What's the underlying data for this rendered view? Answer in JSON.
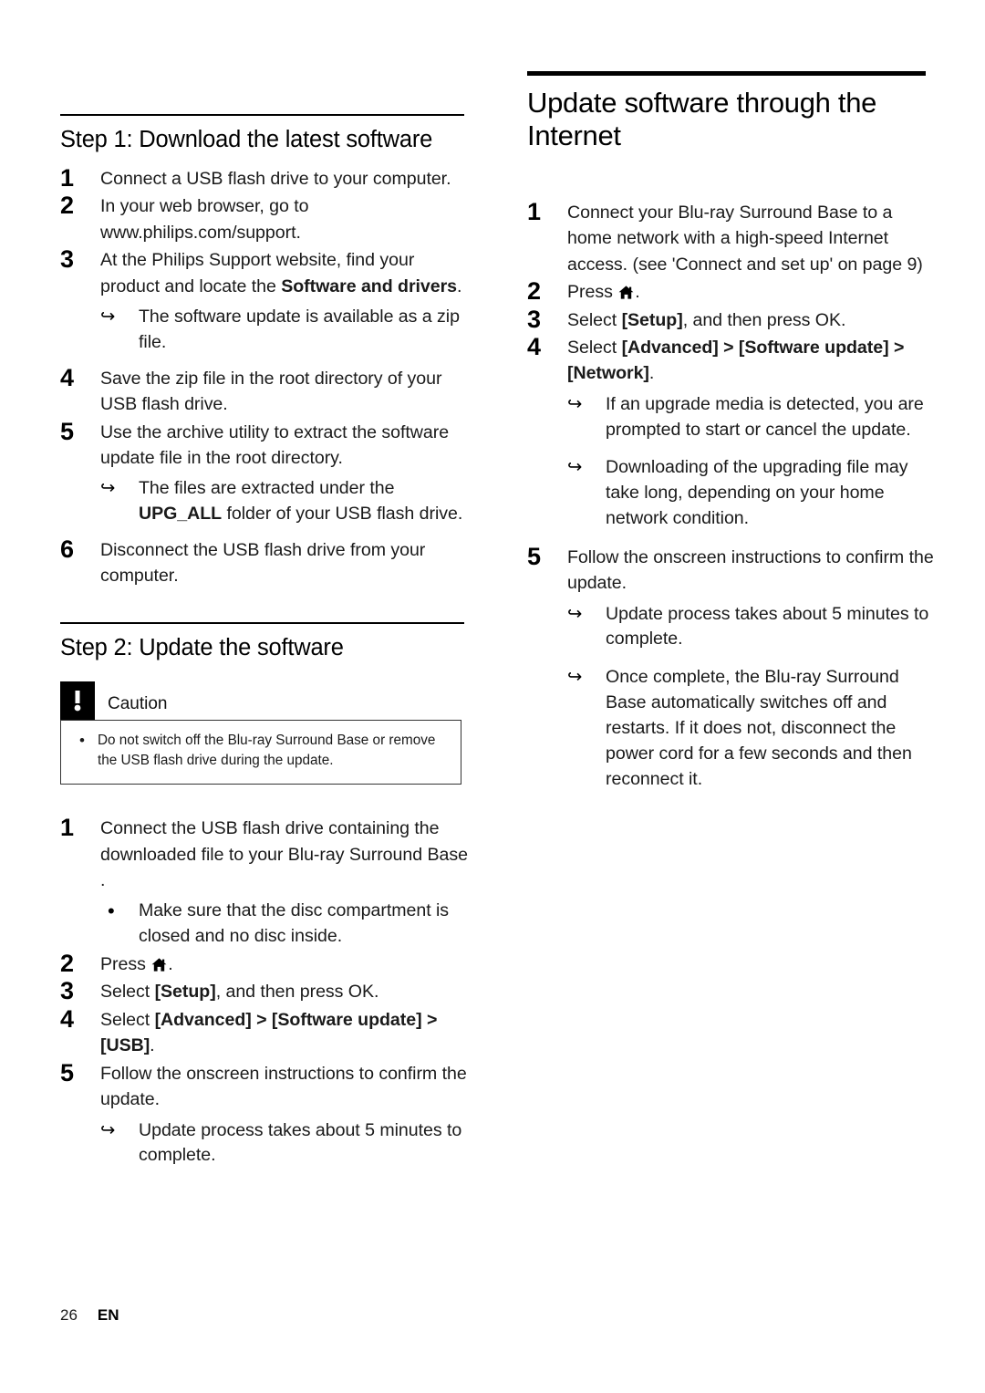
{
  "page": {
    "number": "26",
    "language": "EN"
  },
  "left_column": {
    "step1": {
      "heading": "Step 1: Download the latest software",
      "items": [
        {
          "num": "1",
          "text": "Connect a USB flash drive to your computer."
        },
        {
          "num": "2",
          "text": "In your web browser, go to www.philips.com/support."
        },
        {
          "num": "3",
          "text_before": "At the Philips Support website, find your product and locate the ",
          "bold": "Software and drivers",
          "text_after": ".",
          "subnotes": [
            {
              "marker": "arrow",
              "text": "The software update is available as a zip file."
            }
          ]
        },
        {
          "num": "4",
          "text": "Save the zip file in the root directory of your USB flash drive."
        },
        {
          "num": "5",
          "text": "Use the archive utility to extract the software update file in the root directory.",
          "subnotes": [
            {
              "marker": "arrow",
              "text_before": "The files are extracted under the ",
              "bold": "UPG_ALL",
              "text_after": " folder of your USB flash drive."
            }
          ]
        },
        {
          "num": "6",
          "text": "Disconnect the USB flash drive from your computer."
        }
      ]
    },
    "step2": {
      "heading": "Step 2: Update the software",
      "caution": {
        "title": "Caution",
        "icon": "exclamation-icon",
        "bullets": [
          "Do not switch off the Blu-ray Surround Base  or remove the USB flash drive during the update."
        ]
      },
      "items": [
        {
          "num": "1",
          "text": "Connect the USB flash drive containing the downloaded file to your Blu-ray Surround Base .",
          "subnotes": [
            {
              "marker": "dot",
              "text": "Make sure that the disc compartment is closed and no disc inside."
            }
          ]
        },
        {
          "num": "2",
          "text_before": "Press ",
          "icon": "home-icon",
          "text_after": "."
        },
        {
          "num": "3",
          "text_before": "Select ",
          "bold": "[Setup]",
          "text_after": ", and then press OK."
        },
        {
          "num": "4",
          "text_before": "Select ",
          "bold": "[Advanced] > [Software update] > [USB]",
          "text_after": "."
        },
        {
          "num": "5",
          "text": "Follow the onscreen instructions to confirm the update.",
          "subnotes": [
            {
              "marker": "arrow",
              "text": "Update process takes about 5 minutes to complete."
            }
          ]
        }
      ]
    }
  },
  "right_column": {
    "heading": "Update software through the Internet",
    "items": [
      {
        "num": "1",
        "text": "Connect your Blu-ray Surround Base  to a home network with a high-speed Internet access. (see 'Connect and set up' on page 9)"
      },
      {
        "num": "2",
        "text_before": "Press ",
        "icon": "home-icon",
        "text_after": "."
      },
      {
        "num": "3",
        "text_before": "Select ",
        "bold": "[Setup]",
        "text_after": ", and then press OK."
      },
      {
        "num": "4",
        "text_before": "Select ",
        "bold": "[Advanced] > [Software update] > [Network]",
        "text_after": ".",
        "subnotes": [
          {
            "marker": "arrow",
            "text": "If an upgrade media is detected, you are prompted to start or cancel the update."
          },
          {
            "marker": "arrow",
            "text": "Downloading of the upgrading file may take long, depending on your home network condition."
          }
        ]
      },
      {
        "num": "5",
        "text": "Follow the onscreen instructions to confirm the update.",
        "subnotes": [
          {
            "marker": "arrow",
            "text": "Update process takes about 5 minutes to complete."
          },
          {
            "marker": "arrow",
            "text": "Once complete, the Blu-ray Surround Base  automatically switches off and restarts. If it does not, disconnect the power cord for a few seconds and then reconnect it."
          }
        ]
      }
    ]
  }
}
